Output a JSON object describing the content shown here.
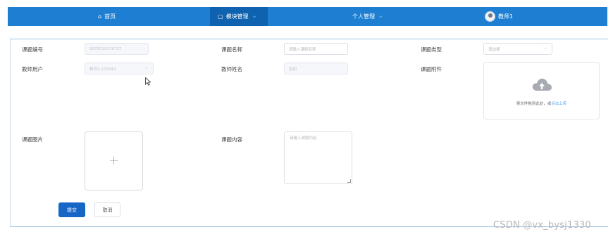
{
  "nav": {
    "items": [
      {
        "icon": "home-icon",
        "glyph": "⌂",
        "label": "首页"
      },
      {
        "icon": "module-icon",
        "glyph": "▢",
        "label": "模块管理"
      },
      {
        "label": "个人管理"
      },
      {
        "icon": "avatar",
        "label": "教师1"
      }
    ]
  },
  "form": {
    "topic_no": {
      "label": "课题编号",
      "value": "1675010176737"
    },
    "topic_name": {
      "label": "课题名称",
      "placeholder": "请输入课题名称"
    },
    "topic_type": {
      "label": "课题类型",
      "placeholder": "请选择"
    },
    "teacher_user": {
      "label": "教师用户",
      "value": "教师1-223344"
    },
    "teacher_name": {
      "label": "教师姓名",
      "value": "张四"
    },
    "attachment": {
      "label": "课题附件",
      "hint": "将文件拖到此处，或",
      "link": "点击上传"
    },
    "picture": {
      "label": "课题图片",
      "plus": "+"
    },
    "content": {
      "label": "课题内容",
      "placeholder": "请输入课题内容"
    }
  },
  "buttons": {
    "submit": "提交",
    "cancel": "取消"
  },
  "watermark": "CSDN @vx_bysj1330",
  "colors": {
    "nav_bg": "#1e7fd2",
    "nav_active": "#0f62b0",
    "primary": "#1766c5",
    "link": "#409eff"
  }
}
